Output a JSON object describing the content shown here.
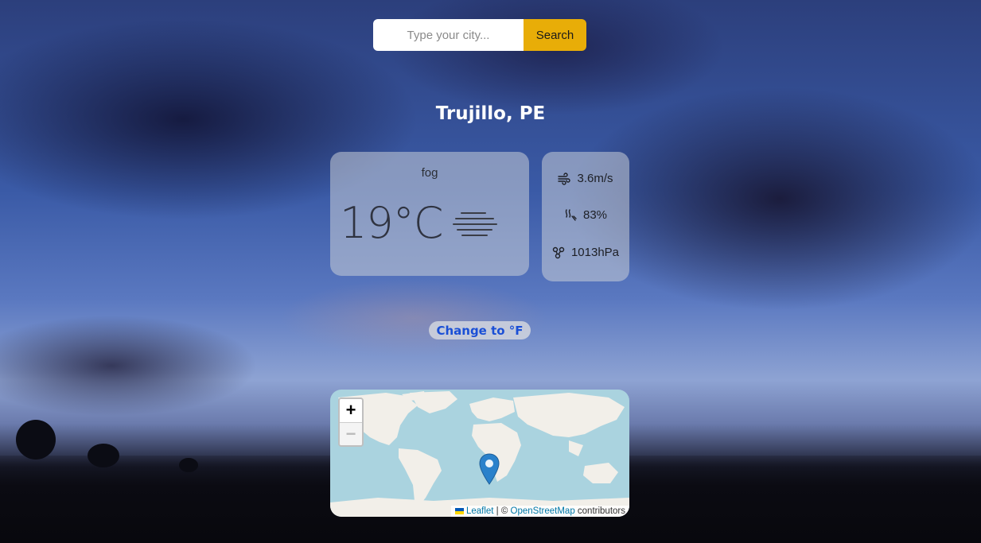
{
  "search": {
    "placeholder": "Type your city...",
    "button_label": "Search"
  },
  "location": {
    "name": "Trujillo, PE"
  },
  "current": {
    "description": "fog",
    "temperature": "19°C",
    "icon": "fog-icon"
  },
  "stats": {
    "wind": {
      "value": "3.6m/s",
      "icon": "wind-icon"
    },
    "humidity": {
      "value": "83%",
      "icon": "humidity-icon"
    },
    "pressure": {
      "value": "1013hPa",
      "icon": "pressure-icon"
    }
  },
  "unit_toggle_label": "Change to °F",
  "map": {
    "zoom_in_label": "+",
    "zoom_out_label": "−",
    "attribution": {
      "leaflet": "Leaflet",
      "separator": " | © ",
      "osm": "OpenStreetMap",
      "suffix": " contributors"
    },
    "marker_icon": "map-marker-icon"
  },
  "colors": {
    "search_button": "#e8ad08",
    "unit_toggle_text": "#1a4fd6",
    "ocean": "#aad3df",
    "land": "#f2efe9",
    "marker": "#2a81cb"
  }
}
